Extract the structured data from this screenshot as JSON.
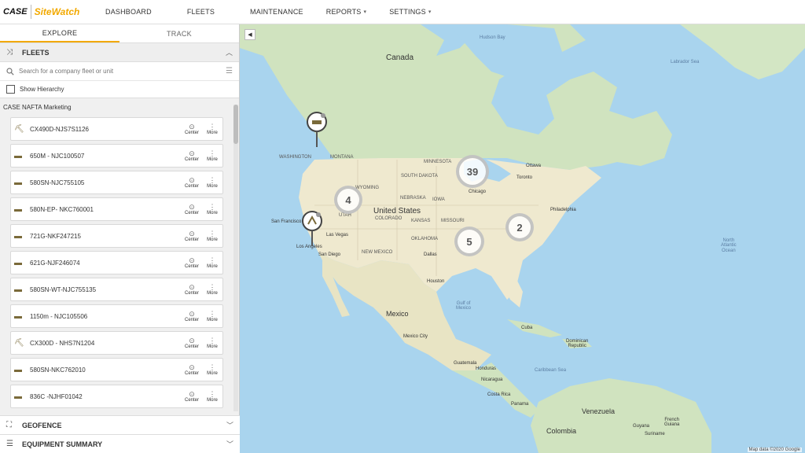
{
  "brand": {
    "case": "CASE",
    "sitewatch": "SiteWatch"
  },
  "nav": [
    {
      "label": "DASHBOARD",
      "caret": false
    },
    {
      "label": "FLEETS",
      "caret": false
    },
    {
      "label": "MAINTENANCE",
      "caret": false
    },
    {
      "label": "REPORTS",
      "caret": true
    },
    {
      "label": "SETTINGS",
      "caret": true
    }
  ],
  "tabs": {
    "explore": "EXPLORE",
    "track": "TRACK"
  },
  "fleets": {
    "title": "FLEETS",
    "search_placeholder": "Search for a company fleet or unit",
    "hierarchy_label": "Show Hierarchy"
  },
  "group": {
    "title": "CASE NAFTA Marketing"
  },
  "units": [
    {
      "name": "CX490D-NJS7S1126"
    },
    {
      "name": "650M - NJC100507"
    },
    {
      "name": "580SN-NJC755105"
    },
    {
      "name": "580N-EP- NKC760001"
    },
    {
      "name": "721G-NKF247215"
    },
    {
      "name": "621G-NJF246074"
    },
    {
      "name": "580SN-WT-NJC755135"
    },
    {
      "name": "1150m - NJC105506"
    },
    {
      "name": "CX300D - NHS7N1204"
    },
    {
      "name": "580SN-NKC762010"
    },
    {
      "name": "836C -NJHF01042"
    }
  ],
  "actions": {
    "center": "Center",
    "more": "More"
  },
  "bottom_sections": {
    "geofence": "GEOFENCE",
    "summary": "EQUIPMENT SUMMARY"
  },
  "map": {
    "labels": {
      "hudson_bay": "Hudson Bay",
      "labrador_sea": "Labrador Sea",
      "canada": "Canada",
      "united_states": "United States",
      "mexico": "Mexico",
      "north_atlantic": "North\nAtlantic\nOcean",
      "gulf": "Gulf of\nMexico",
      "cuba": "Cuba",
      "dominican": "Dominican\nRepublic",
      "caribbean": "Caribbean Sea",
      "guatemala": "Guatemala",
      "honduras": "Honduras",
      "nicaragua": "Nicaragua",
      "costa_rica": "Costa Rica",
      "panama": "Panama",
      "venezuela": "Venezuela",
      "colombia": "Colombia",
      "guyana": "Guyana",
      "suriname": "Suriname",
      "french_guiana": "French\nGuiana",
      "washington": "WASHINGTON",
      "minnesota": "MINNESOTA",
      "nebraska": "NEBRASKA",
      "utah": "UTAH",
      "colorado": "COLORADO",
      "oklahoma": "OKLAHOMA",
      "new_mexico": "NEW MEXICO",
      "kansas": "KANSAS",
      "missouri": "MISSOURI",
      "montana": "MONTANA",
      "wyoming": "WYOMING",
      "south_dakota": "SOUTH DAKOTA",
      "iowa": "IOWA",
      "san_francisco": "San Francisco",
      "las_vegas": "Las Vegas",
      "los_angeles": "Los Angeles",
      "san_diego": "San Diego",
      "chicago": "Chicago",
      "toronto": "Toronto",
      "ottawa": "Ottawa",
      "dallas": "Dallas",
      "houston": "Houston",
      "philadelphia": "Philadelphia",
      "mexico_city": "Mexico City"
    },
    "clusters": [
      {
        "count": "4"
      },
      {
        "count": "39"
      },
      {
        "count": "5"
      },
      {
        "count": "2"
      }
    ],
    "attribution": "Map data ©2020 Google"
  }
}
